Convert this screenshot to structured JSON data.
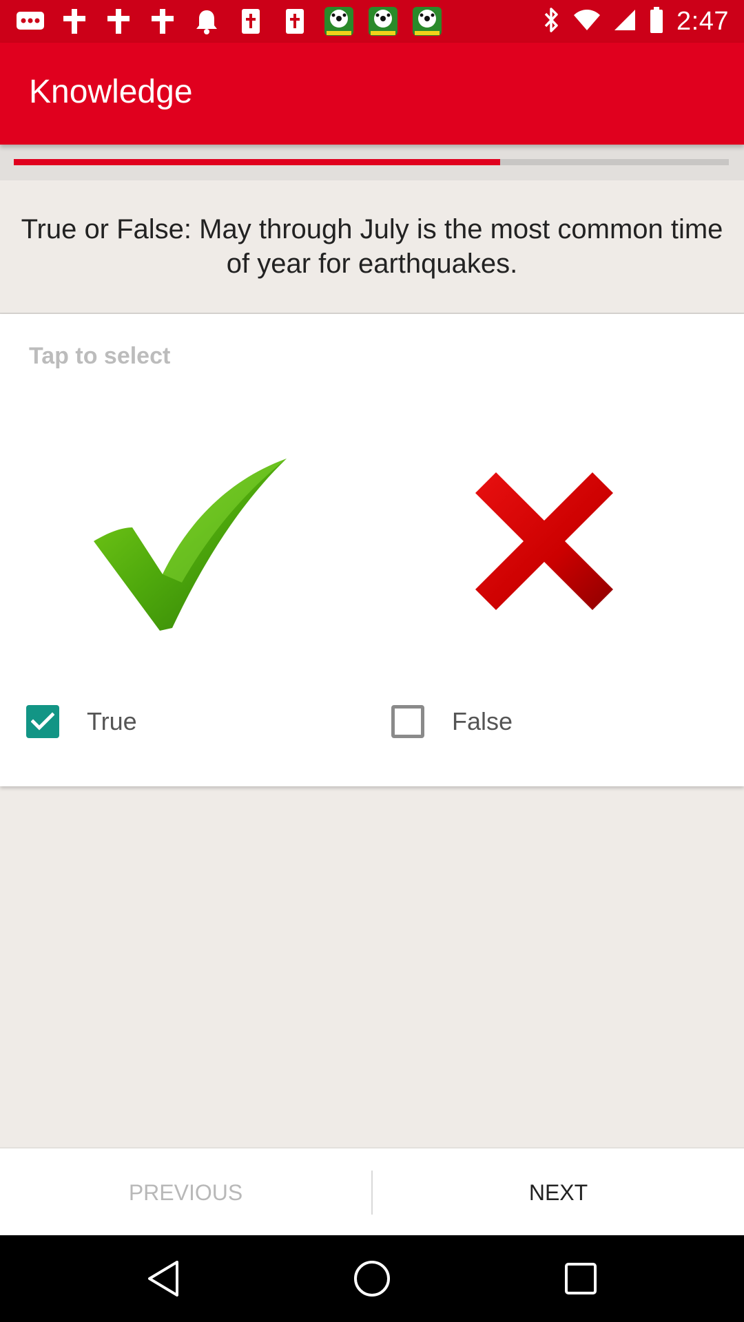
{
  "status_bar": {
    "time": "2:47",
    "icons": [
      "more-messages-icon",
      "cross-icon",
      "cross-icon",
      "cross-icon",
      "bell-icon",
      "bible-icon",
      "bible-icon",
      "soccer-app-icon",
      "soccer-app-icon",
      "soccer-app-icon"
    ],
    "right_icons": [
      "bluetooth-icon",
      "wifi-icon",
      "cell-signal-icon",
      "battery-icon"
    ]
  },
  "app_bar": {
    "title": "Knowledge"
  },
  "progress": {
    "fraction": 0.68
  },
  "question": {
    "text": "True or False: May through July is the most common time of year for earthquakes."
  },
  "options": {
    "hint": "Tap to select",
    "items": [
      {
        "label": "True",
        "icon": "green-check-icon",
        "checked": true
      },
      {
        "label": "False",
        "icon": "red-x-icon",
        "checked": false
      }
    ]
  },
  "bottom_nav": {
    "previous_label": "PREVIOUS",
    "next_label": "NEXT"
  },
  "colors": {
    "primary": "#e0001e",
    "status_bar": "#cc0018",
    "checkbox_checked": "#129585",
    "background": "#efebe7"
  },
  "system_nav": [
    "back-icon",
    "home-icon",
    "recents-icon"
  ]
}
